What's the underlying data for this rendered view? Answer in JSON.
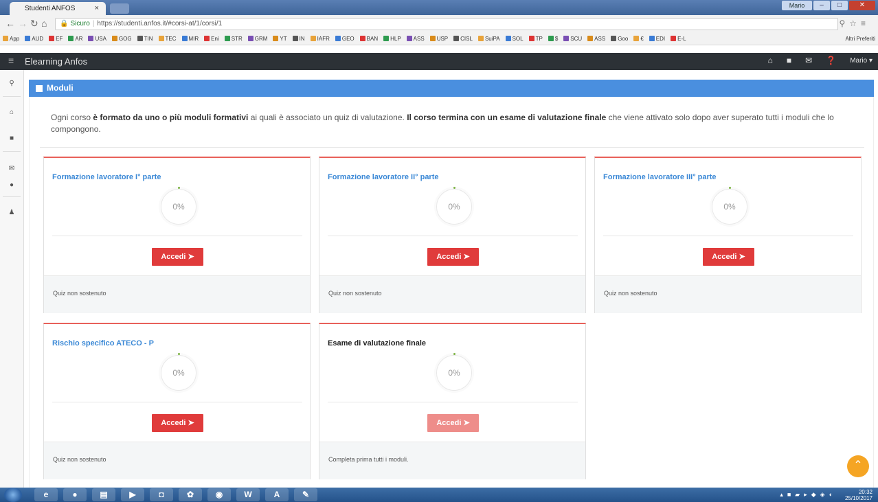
{
  "browser": {
    "tab_title": "Studenti ANFOS",
    "tab_close": "×",
    "url_secure": "Sicuro",
    "url": "https://studenti.anfos.it/#corsi-at/1/corsi/1",
    "bookmarks": [
      "App",
      "AUD",
      "EF",
      "AR",
      "USA",
      "GOG",
      "TIN",
      "TEC",
      "MIR",
      "Eni",
      "STR",
      "GRM",
      "YT",
      "IN",
      "IAFR",
      "GEO",
      "BAN",
      "HLP",
      "ASS",
      "USP",
      "CISL",
      "SuiPA",
      "SOL",
      "TP",
      "$",
      "SCU",
      "ASS",
      "Goo",
      "€",
      "EDI",
      "E-L"
    ],
    "bookmarks_more": "Altri Preferiti",
    "user_btn": "Mario"
  },
  "navbar": {
    "brand": "Elearning Anfos",
    "user": "Mario ▾"
  },
  "panel": {
    "title": "Moduli",
    "intro_part1": "Ogni corso ",
    "intro_bold1": "è formato da uno o più moduli formativi",
    "intro_part2": " ai quali è associato un quiz di valutazione. ",
    "intro_bold2": "Il corso termina con un esame di valutazione finale",
    "intro_part3": " che viene attivato solo dopo aver superato tutti i moduli che lo compongono."
  },
  "modules": [
    {
      "title": "Formazione lavoratore I° parte",
      "progress": "0%",
      "button": "Accedi",
      "status": "Quiz non sostenuto",
      "enabled": true
    },
    {
      "title": "Formazione lavoratore II° parte",
      "progress": "0%",
      "button": "Accedi",
      "status": "Quiz non sostenuto",
      "enabled": true
    },
    {
      "title": "Formazione lavoratore III° parte",
      "progress": "0%",
      "button": "Accedi",
      "status": "Quiz non sostenuto",
      "enabled": true
    },
    {
      "title": "Rischio specifico ATECO - P",
      "progress": "0%",
      "button": "Accedi",
      "status": "Quiz non sostenuto",
      "enabled": true
    },
    {
      "title": "Esame di valutazione finale",
      "progress": "0%",
      "button": "Accedi",
      "status": "Completa prima tutti i moduli.",
      "enabled": false
    }
  ],
  "taskbar": {
    "time": "20:32",
    "date": "25/10/2017"
  },
  "colors": {
    "panel_header": "#4a8fdf",
    "button_red": "#e03b3b",
    "button_disabled": "#ee8d8a",
    "module_title": "#3a88d6",
    "scroll_top": "#f5a524"
  }
}
